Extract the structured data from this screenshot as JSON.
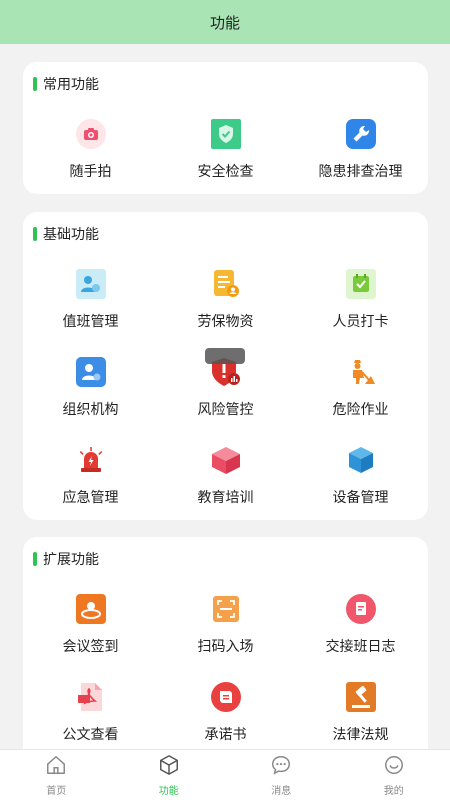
{
  "header": {
    "title": "功能"
  },
  "sections": {
    "common": {
      "title": "常用功能",
      "items": [
        {
          "label": "随手拍",
          "icon": "camera-icon"
        },
        {
          "label": "安全检查",
          "icon": "shield-check-icon"
        },
        {
          "label": "隐患排查治理",
          "icon": "wrench-icon"
        }
      ]
    },
    "basic": {
      "title": "基础功能",
      "items": [
        {
          "label": "值班管理",
          "icon": "duty-users-icon"
        },
        {
          "label": "劳保物资",
          "icon": "supplies-document-icon"
        },
        {
          "label": "人员打卡",
          "icon": "check-in-icon"
        },
        {
          "label": "组织机构",
          "icon": "organization-icon"
        },
        {
          "label": "风险管控",
          "icon": "risk-shield-icon"
        },
        {
          "label": "危险作业",
          "icon": "hazard-worker-icon"
        },
        {
          "label": "应急管理",
          "icon": "emergency-alarm-icon"
        },
        {
          "label": "教育培训",
          "icon": "education-box-icon"
        },
        {
          "label": "设备管理",
          "icon": "equipment-cube-icon"
        }
      ]
    },
    "extended": {
      "title": "扩展功能",
      "items": [
        {
          "label": "会议签到",
          "icon": "meeting-checkin-icon"
        },
        {
          "label": "扫码入场",
          "icon": "scan-qr-icon"
        },
        {
          "label": "交接班日志",
          "icon": "shift-log-icon"
        },
        {
          "label": "公文查看",
          "icon": "pdf-document-icon"
        },
        {
          "label": "承诺书",
          "icon": "commitment-book-icon"
        },
        {
          "label": "法律法规",
          "icon": "law-gavel-icon"
        }
      ]
    }
  },
  "tabbar": {
    "items": [
      {
        "label": "首页",
        "icon": "home-icon"
      },
      {
        "label": "功能",
        "icon": "function-cube-icon"
      },
      {
        "label": "消息",
        "icon": "message-icon"
      },
      {
        "label": "我的",
        "icon": "profile-smile-icon"
      }
    ],
    "active_color": "#2ec353"
  },
  "colors": {
    "header_bg": "#a8e4b4",
    "accent_green": "#2ec353"
  }
}
